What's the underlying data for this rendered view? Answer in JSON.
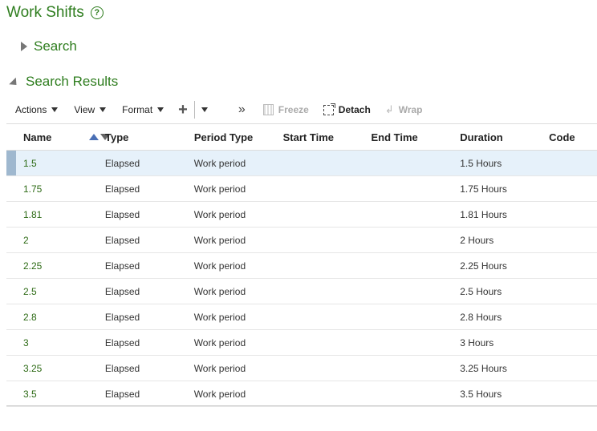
{
  "page": {
    "title": "Work Shifts"
  },
  "search_section": {
    "label": "Search"
  },
  "results_section": {
    "label": "Search Results"
  },
  "toolbar": {
    "actions": "Actions",
    "view": "View",
    "format": "Format",
    "freeze": "Freeze",
    "detach": "Detach",
    "wrap": "Wrap"
  },
  "table": {
    "headers": {
      "name": "Name",
      "type": "Type",
      "period_type": "Period Type",
      "start_time": "Start Time",
      "end_time": "End Time",
      "duration": "Duration",
      "code": "Code"
    },
    "rows": [
      {
        "name": "1.5",
        "type": "Elapsed",
        "period_type": "Work period",
        "start_time": "",
        "end_time": "",
        "duration": "1.5  Hours",
        "code": ""
      },
      {
        "name": "1.75",
        "type": "Elapsed",
        "period_type": "Work period",
        "start_time": "",
        "end_time": "",
        "duration": "1.75  Hours",
        "code": ""
      },
      {
        "name": "1.81",
        "type": "Elapsed",
        "period_type": "Work period",
        "start_time": "",
        "end_time": "",
        "duration": "1.81  Hours",
        "code": ""
      },
      {
        "name": "2",
        "type": "Elapsed",
        "period_type": "Work period",
        "start_time": "",
        "end_time": "",
        "duration": "2  Hours",
        "code": ""
      },
      {
        "name": "2.25",
        "type": "Elapsed",
        "period_type": "Work period",
        "start_time": "",
        "end_time": "",
        "duration": "2.25  Hours",
        "code": ""
      },
      {
        "name": "2.5",
        "type": "Elapsed",
        "period_type": "Work period",
        "start_time": "",
        "end_time": "",
        "duration": "2.5  Hours",
        "code": ""
      },
      {
        "name": "2.8",
        "type": "Elapsed",
        "period_type": "Work period",
        "start_time": "",
        "end_time": "",
        "duration": "2.8  Hours",
        "code": ""
      },
      {
        "name": "3",
        "type": "Elapsed",
        "period_type": "Work period",
        "start_time": "",
        "end_time": "",
        "duration": "3  Hours",
        "code": ""
      },
      {
        "name": "3.25",
        "type": "Elapsed",
        "period_type": "Work period",
        "start_time": "",
        "end_time": "",
        "duration": "3.25  Hours",
        "code": ""
      },
      {
        "name": "3.5",
        "type": "Elapsed",
        "period_type": "Work period",
        "start_time": "",
        "end_time": "",
        "duration": "3.5  Hours",
        "code": ""
      }
    ]
  }
}
